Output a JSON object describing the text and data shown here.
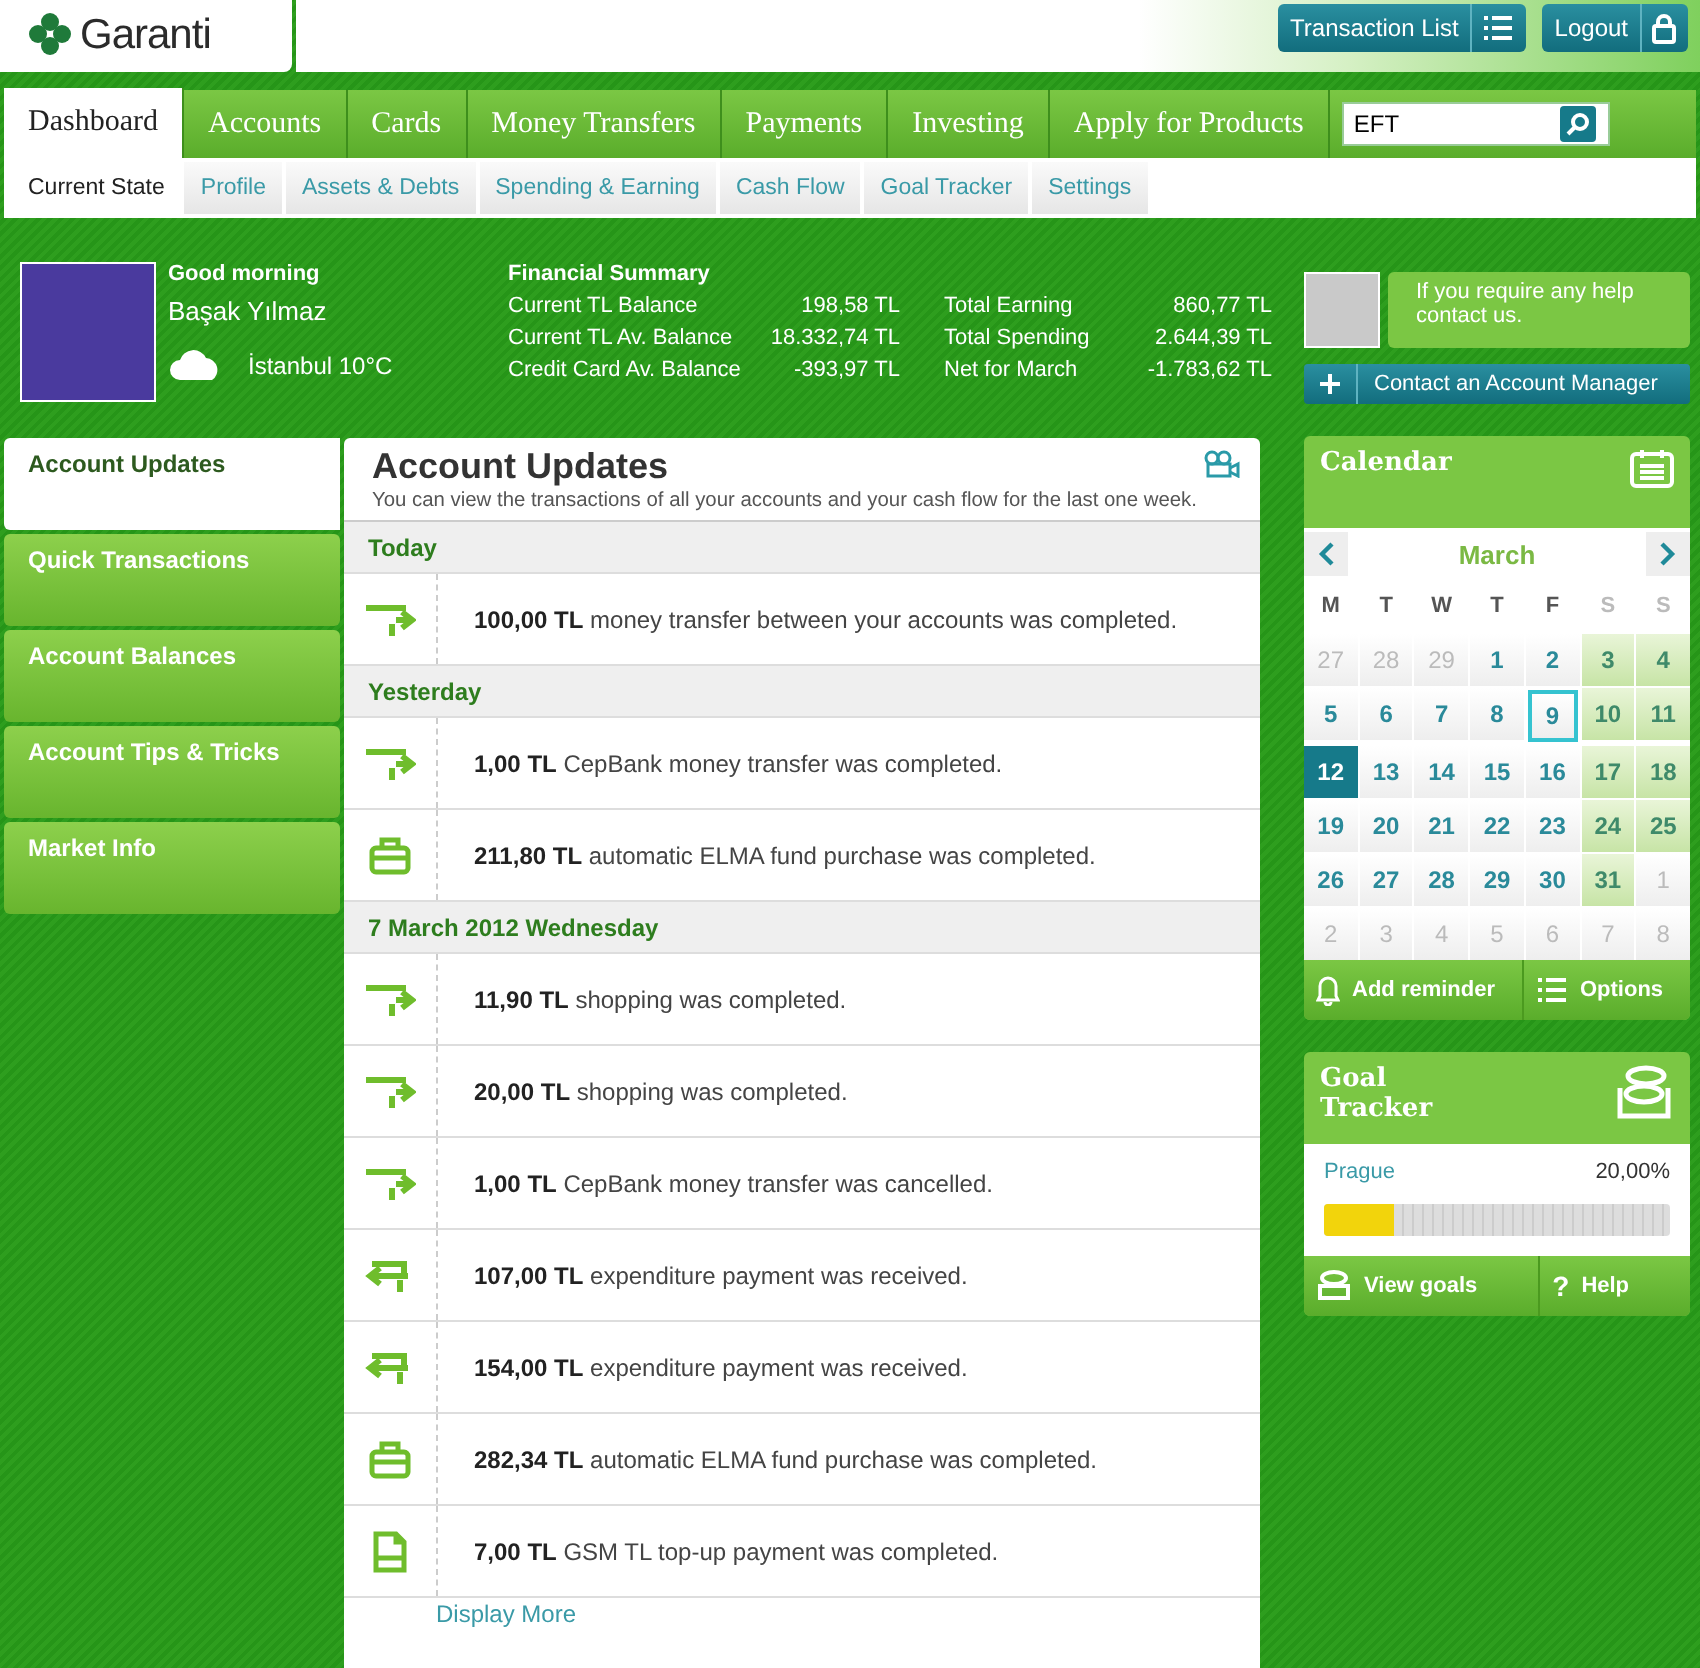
{
  "header": {
    "logo": "Garanti",
    "buttons": [
      {
        "label": "Transaction List",
        "kind": "list"
      },
      {
        "label": "Logout",
        "kind": "lock"
      }
    ]
  },
  "tabs": [
    {
      "label": "Dashboard",
      "selected": true
    },
    {
      "label": "Accounts",
      "selected": false
    },
    {
      "label": "Cards",
      "selected": false
    },
    {
      "label": "Money Transfers",
      "selected": false
    },
    {
      "label": "Payments",
      "selected": false
    },
    {
      "label": "Investing",
      "selected": false
    },
    {
      "label": "Apply for Products",
      "selected": false
    }
  ],
  "search": {
    "value": "EFT"
  },
  "subtabs": [
    {
      "label": "Current State",
      "selected": true
    },
    {
      "label": "Profile",
      "selected": false
    },
    {
      "label": "Assets & Debts",
      "selected": false
    },
    {
      "label": "Spending & Earning",
      "selected": false
    },
    {
      "label": "Cash Flow",
      "selected": false
    },
    {
      "label": "Goal Tracker",
      "selected": false
    },
    {
      "label": "Settings",
      "selected": false
    }
  ],
  "profile": {
    "greeting": "Good morning",
    "name": "Başak Yılmaz",
    "weather": "İstanbul 10°C"
  },
  "summary": {
    "title": "Financial Summary",
    "columns": [
      [
        {
          "label": "Current TL Balance",
          "value": "198,58 TL"
        },
        {
          "label": "Current TL Av. Balance",
          "value": "18.332,74 TL"
        },
        {
          "label": "Credit Card Av. Balance",
          "value": "-393,97 TL"
        }
      ],
      [
        {
          "label": "Total Earning",
          "value": "860,77 TL"
        },
        {
          "label": "Total Spending",
          "value": "2.644,39 TL"
        },
        {
          "label": "Net for March",
          "value": "-1.783,62 TL"
        }
      ]
    ]
  },
  "side_menu": [
    {
      "label": "Account Updates",
      "selected": true
    },
    {
      "label": "Quick Transactions",
      "selected": false
    },
    {
      "label": "Account Balances",
      "selected": false
    },
    {
      "label": "Account Tips & Tricks",
      "selected": false
    },
    {
      "label": "Market Info",
      "selected": false
    }
  ],
  "updates": {
    "title": "Account Updates",
    "subtitle": "You can view the transactions of all your accounts and your cash flow for the last one week.",
    "groups": [
      {
        "date": "Today",
        "items": [
          {
            "kind": "transfer",
            "text": "**100,00 TL** money transfer between your accounts was completed."
          }
        ]
      },
      {
        "date": "Yesterday",
        "items": [
          {
            "kind": "transfer",
            "text": "**1,00 TL** CepBank money transfer was completed."
          },
          {
            "kind": "fund",
            "text": "**211,80 TL** automatic ELMA fund purchase was completed."
          }
        ]
      },
      {
        "date": "7 March 2012 Wednesday",
        "items": [
          {
            "kind": "transfer",
            "text": "**11,90 TL** shopping was completed."
          },
          {
            "kind": "transfer",
            "text": "**20,00 TL** shopping was completed."
          },
          {
            "kind": "transfer",
            "text": "**1,00 TL** CepBank money transfer was cancelled."
          },
          {
            "kind": "incoming",
            "text": "**107,00 TL** expenditure payment was received."
          },
          {
            "kind": "incoming",
            "text": "**154,00 TL** expenditure payment was received."
          },
          {
            "kind": "fund",
            "text": "**282,34 TL** automatic ELMA fund purchase was completed."
          },
          {
            "kind": "topup",
            "text": "**7,00 TL** GSM TL top-up payment was completed."
          }
        ]
      }
    ],
    "more": "Display More"
  },
  "help": {
    "text": "If you require any help contact us.",
    "button": "Contact an Account Manager"
  },
  "calendar": {
    "title": "Calendar",
    "month": "March",
    "weekdays": [
      {
        "label": "M",
        "weekend": false
      },
      {
        "label": "T",
        "weekend": false
      },
      {
        "label": "W",
        "weekend": false
      },
      {
        "label": "T",
        "weekend": false
      },
      {
        "label": "F",
        "weekend": false
      },
      {
        "label": "S",
        "weekend": true
      },
      {
        "label": "S",
        "weekend": true
      }
    ],
    "days": [
      {
        "label": "27",
        "kind": "other"
      },
      {
        "label": "28",
        "kind": "other"
      },
      {
        "label": "29",
        "kind": "other"
      },
      {
        "label": "1",
        "kind": "day"
      },
      {
        "label": "2",
        "kind": "day"
      },
      {
        "label": "3",
        "kind": "weekend"
      },
      {
        "label": "4",
        "kind": "weekend"
      },
      {
        "label": "5",
        "kind": "day"
      },
      {
        "label": "6",
        "kind": "day"
      },
      {
        "label": "7",
        "kind": "day"
      },
      {
        "label": "8",
        "kind": "day"
      },
      {
        "label": "9",
        "kind": "marked"
      },
      {
        "label": "10",
        "kind": "weekend"
      },
      {
        "label": "11",
        "kind": "weekend"
      },
      {
        "label": "12",
        "kind": "today"
      },
      {
        "label": "13",
        "kind": "day"
      },
      {
        "label": "14",
        "kind": "day"
      },
      {
        "label": "15",
        "kind": "day"
      },
      {
        "label": "16",
        "kind": "day"
      },
      {
        "label": "17",
        "kind": "weekend"
      },
      {
        "label": "18",
        "kind": "weekend"
      },
      {
        "label": "19",
        "kind": "day"
      },
      {
        "label": "20",
        "kind": "day"
      },
      {
        "label": "21",
        "kind": "day"
      },
      {
        "label": "22",
        "kind": "day"
      },
      {
        "label": "23",
        "kind": "day"
      },
      {
        "label": "24",
        "kind": "weekend"
      },
      {
        "label": "25",
        "kind": "weekend"
      },
      {
        "label": "26",
        "kind": "day"
      },
      {
        "label": "27",
        "kind": "day"
      },
      {
        "label": "28",
        "kind": "day"
      },
      {
        "label": "29",
        "kind": "day"
      },
      {
        "label": "30",
        "kind": "day"
      },
      {
        "label": "31",
        "kind": "weekend"
      },
      {
        "label": "1",
        "kind": "other"
      },
      {
        "label": "2",
        "kind": "other"
      },
      {
        "label": "3",
        "kind": "other"
      },
      {
        "label": "4",
        "kind": "other"
      },
      {
        "label": "5",
        "kind": "other"
      },
      {
        "label": "6",
        "kind": "other"
      },
      {
        "label": "7",
        "kind": "other"
      },
      {
        "label": "8",
        "kind": "other"
      }
    ],
    "buttons": [
      {
        "label": "Add reminder",
        "kind": "bell"
      },
      {
        "label": "Options",
        "kind": "list"
      }
    ]
  },
  "goal": {
    "title": "Goal Tracker",
    "name": "Prague",
    "percent": "20,00%",
    "level": 0.2,
    "buttons": [
      {
        "label": "View goals",
        "kind": "coins"
      },
      {
        "label": "Help",
        "kind": "help",
        "icon": "?"
      }
    ]
  }
}
